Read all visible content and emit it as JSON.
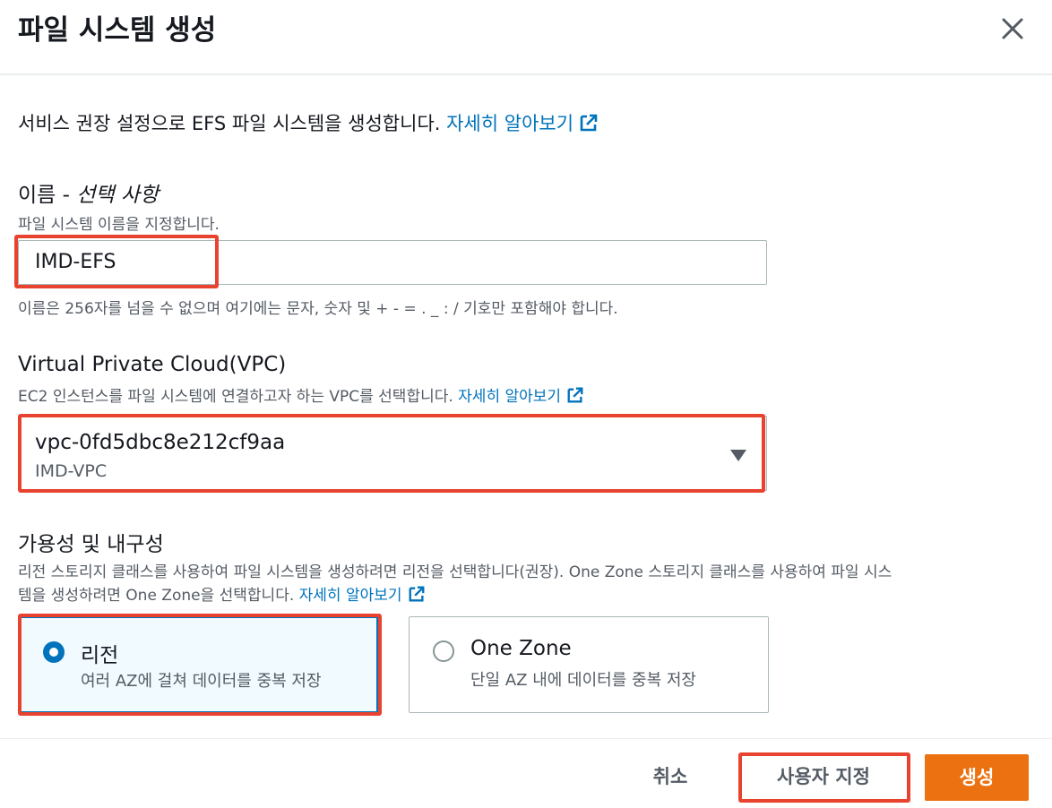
{
  "modal": {
    "title": "파일 시스템 생성",
    "close_label": "close-icon"
  },
  "intro": {
    "text": "서비스 권장 설정으로 EFS 파일 시스템을 생성합니다. ",
    "link": "자세히 알아보기"
  },
  "name_field": {
    "label": "이름 - ",
    "label_optional": "선택 사항",
    "description": "파일 시스템 이름을 지정합니다.",
    "value": "IMD-EFS",
    "constraint": "이름은 256자를 넘을 수 없으며 여기에는 문자, 숫자 및 + - = . _ : / 기호만 포함해야 합니다."
  },
  "vpc_field": {
    "label": "Virtual Private Cloud(VPC)",
    "description": "EC2 인스턴스를 파일 시스템에 연결하고자 하는 VPC를 선택합니다. ",
    "link": "자세히 알아보기",
    "selected_value": "vpc-0fd5dbc8e212cf9aa",
    "selected_sub": "IMD-VPC"
  },
  "availability": {
    "label": "가용성 및 내구성",
    "description_line1": "리전 스토리지 클래스를 사용하여 파일 시스템을 생성하려면 리전을 선택합니다(권장). One Zone 스토리지 클래스를 사용하여 파일 시스",
    "description_line2": "템을 생성하려면 One Zone을 선택합니다. ",
    "link": "자세히 알아보기",
    "options": [
      {
        "name": "리전",
        "desc": "여러 AZ에 걸쳐 데이터를 중복 저장",
        "selected": true
      },
      {
        "name": "One Zone",
        "desc": "단일 AZ 내에 데이터를 중복 저장",
        "selected": false
      }
    ]
  },
  "footer": {
    "cancel": "취소",
    "custom": "사용자 지정",
    "create": "생성"
  },
  "colors": {
    "link": "#0073bb",
    "primary_button": "#ec7211",
    "highlight_annotation": "#e8432f",
    "selected_tile_bg": "#f1faff"
  }
}
